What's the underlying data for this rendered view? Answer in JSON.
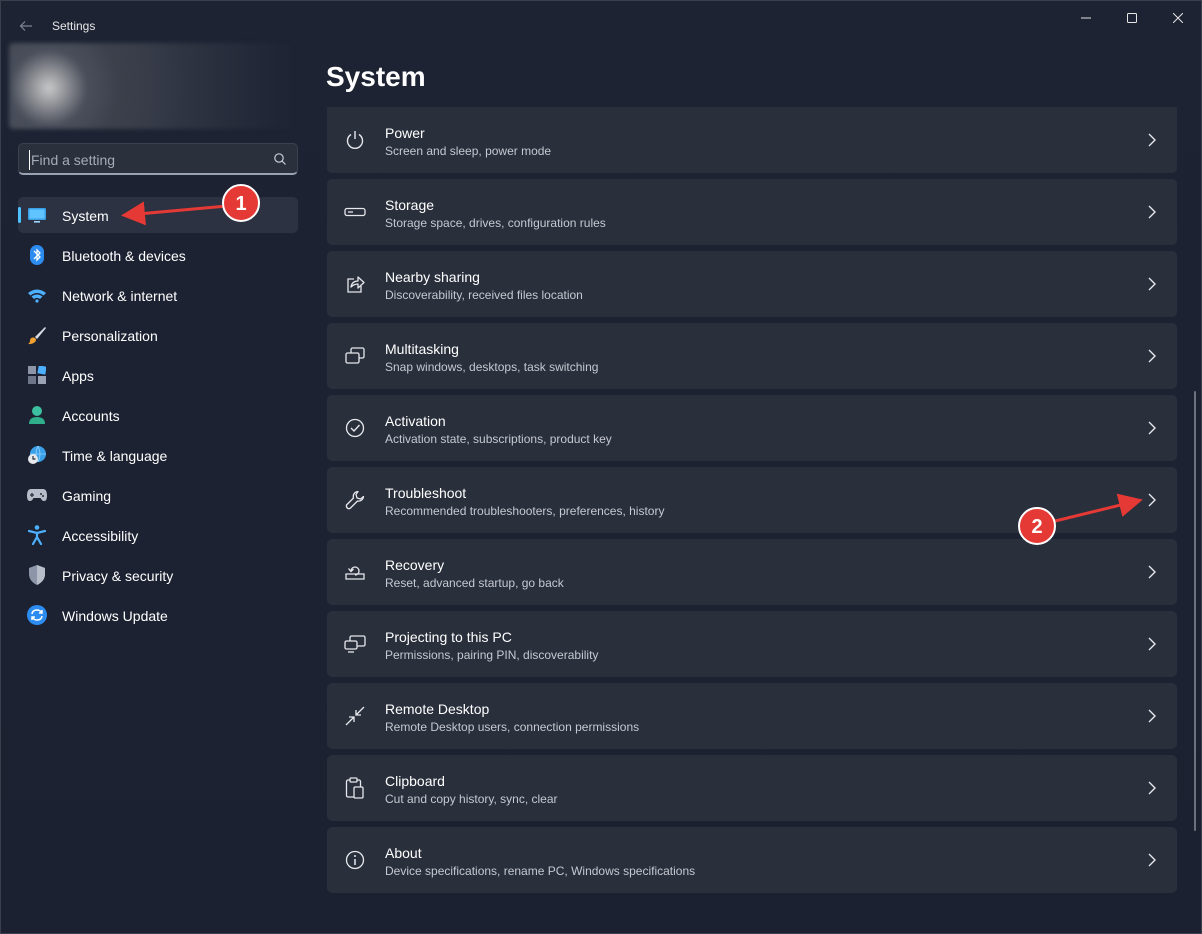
{
  "window": {
    "title": "Settings"
  },
  "search": {
    "placeholder": "Find a setting"
  },
  "sidebar": {
    "items": [
      {
        "label": "System",
        "icon": "system-monitor-icon",
        "active": true
      },
      {
        "label": "Bluetooth & devices",
        "icon": "bluetooth-icon"
      },
      {
        "label": "Network & internet",
        "icon": "wifi-icon"
      },
      {
        "label": "Personalization",
        "icon": "paintbrush-icon"
      },
      {
        "label": "Apps",
        "icon": "apps-icon"
      },
      {
        "label": "Accounts",
        "icon": "account-icon"
      },
      {
        "label": "Time & language",
        "icon": "globe-clock-icon"
      },
      {
        "label": "Gaming",
        "icon": "gamepad-icon"
      },
      {
        "label": "Accessibility",
        "icon": "accessibility-icon"
      },
      {
        "label": "Privacy & security",
        "icon": "shield-icon"
      },
      {
        "label": "Windows Update",
        "icon": "update-icon"
      }
    ]
  },
  "main": {
    "title": "System",
    "items": [
      {
        "title": "Power",
        "desc": "Screen and sleep, power mode",
        "icon": "power-icon"
      },
      {
        "title": "Storage",
        "desc": "Storage space, drives, configuration rules",
        "icon": "storage-drive-icon"
      },
      {
        "title": "Nearby sharing",
        "desc": "Discoverability, received files location",
        "icon": "share-icon"
      },
      {
        "title": "Multitasking",
        "desc": "Snap windows, desktops, task switching",
        "icon": "multitasking-icon"
      },
      {
        "title": "Activation",
        "desc": "Activation state, subscriptions, product key",
        "icon": "checkmark-circle-icon"
      },
      {
        "title": "Troubleshoot",
        "desc": "Recommended troubleshooters, preferences, history",
        "icon": "wrench-icon"
      },
      {
        "title": "Recovery",
        "desc": "Reset, advanced startup, go back",
        "icon": "recovery-icon"
      },
      {
        "title": "Projecting to this PC",
        "desc": "Permissions, pairing PIN, discoverability",
        "icon": "projecting-icon"
      },
      {
        "title": "Remote Desktop",
        "desc": "Remote Desktop users, connection permissions",
        "icon": "remote-desktop-icon"
      },
      {
        "title": "Clipboard",
        "desc": "Cut and copy history, sync, clear",
        "icon": "clipboard-icon"
      },
      {
        "title": "About",
        "desc": "Device specifications, rename PC, Windows specifications",
        "icon": "info-icon"
      }
    ]
  },
  "annotations": [
    {
      "label": "1"
    },
    {
      "label": "2"
    }
  ],
  "colors": {
    "accent": "#4cc2ff",
    "annotation": "#e53935",
    "background": "#1c2230",
    "card": "#2a2f3c"
  }
}
